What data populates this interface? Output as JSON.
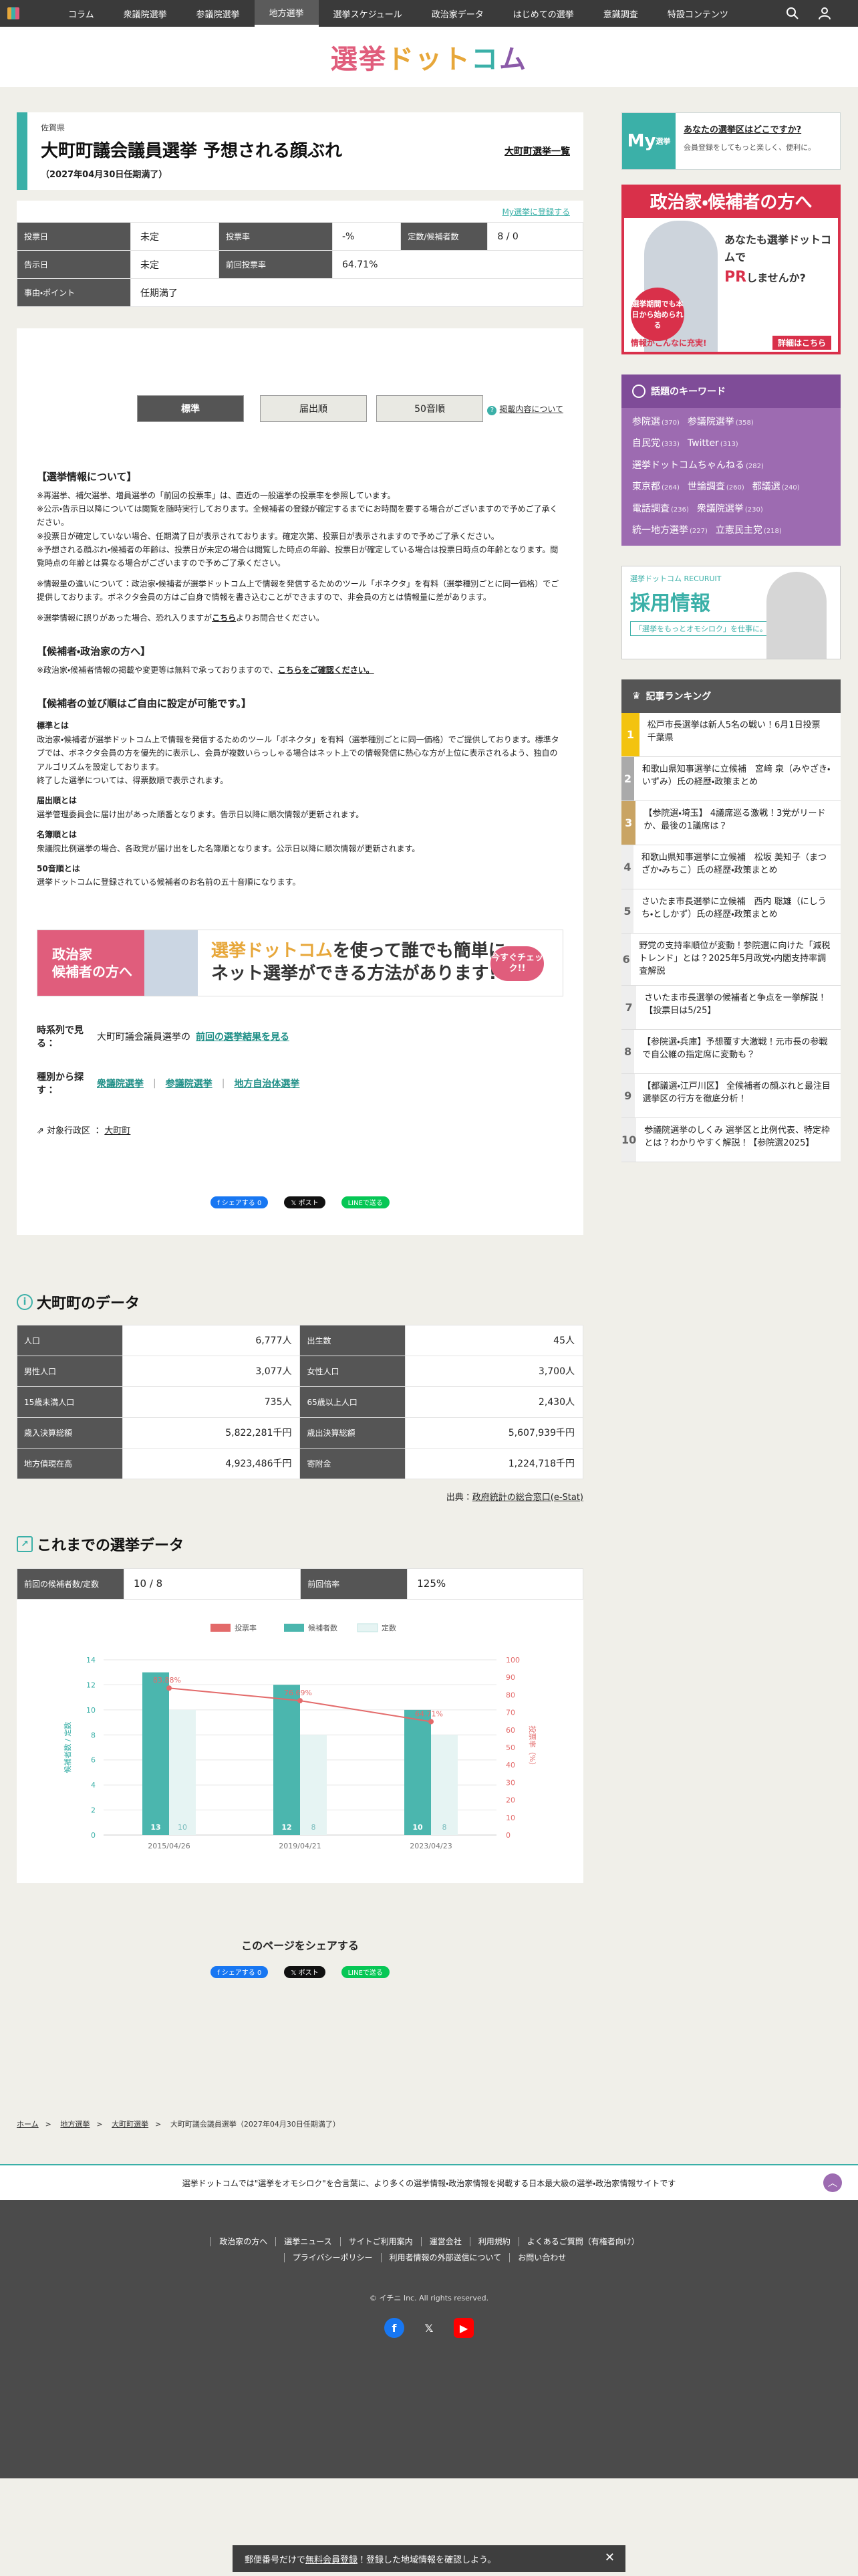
{
  "nav": {
    "items": [
      "コラム",
      "衆議院選挙",
      "参議院選挙",
      "地方選挙",
      "選挙スケジュール",
      "政治家データ",
      "はじめての選挙",
      "意識調査",
      "特設コンテンツ"
    ],
    "active_index": 3
  },
  "site": {
    "logo": [
      "選挙",
      "ドット",
      "コ",
      "ム"
    ]
  },
  "election": {
    "prefecture": "佐賀県",
    "title": "大町町議会議員選挙 予想される顔ぶれ",
    "date": "（2027年04月30日任期満了）",
    "list_link": "大町町選挙一覧"
  },
  "summary": {
    "register_link": "My選挙に登録する",
    "rows": [
      [
        {
          "label": "投票日",
          "value": "未定"
        },
        {
          "label": "投票率",
          "value": "-%"
        },
        {
          "label": "定数/候補者数",
          "value": "8 / 0"
        }
      ],
      [
        {
          "label": "告示日",
          "value": "未定"
        },
        {
          "label": "前回投票率",
          "value": "64.71%"
        }
      ],
      [
        {
          "label": "事由・ポイント",
          "value": "任期満了"
        }
      ]
    ]
  },
  "tabs": {
    "items": [
      "標準",
      "届出順",
      "50音順"
    ],
    "active": 0,
    "about": "掲載内容について"
  },
  "info": {
    "h1": "【選挙情報について】",
    "p1": "※再選挙、補欠選挙、増員選挙の「前回の投票率」は、直近の一般選挙の投票率を参照しています。",
    "p2": "※公示・告示日以降については閲覧を随時実行しております。全候補者の登録が確定するまでにお時間を要する場合がございますので予めご了承ください。",
    "p3": "※投票日が確定していない場合、任期満了日が表示されております。確定次第、投票日が表示されますので予めご了承ください。",
    "p4": "※予想される顔ぶれ・候補者の年齢は、投票日が未定の場合は閲覧した時点の年齢、投票日が確定している場合は投票日時点の年齢となります。閲覧時点の年齢とは異なる場合がございますので予めご了承ください。",
    "p5": "※情報量の違いについて：政治家・候補者が選挙ドットコム上で情報を発信するためのツール「ボネクタ」を有料（選挙種別ごとに同一価格）でご提供しております。ボネクタ会員の方はご自身で情報を書き込むことができますので、非会員の方とは情報量に差があります。",
    "p6a": "※選挙情報に誤りがあった場合、恐れ入りますが",
    "p6b": "こちら",
    "p6c": "よりお問合せください。",
    "h2": "【候補者・政治家の方へ】",
    "p7a": "※政治家・候補者情報の掲載や変更等は無料で承っておりますので、",
    "p7b": "こちらをご確認ください。",
    "h3": "【候補者の並び順はご自由に設定が可能です。】",
    "s1": "標準とは",
    "s1t": "政治家・候補者が選挙ドットコム上で情報を発信するためのツール「ボネクタ」を有料（選挙種別ごとに同一価格）でご提供しております。標準タブでは、ボネクタ会員の方を優先的に表示し、会員が複数いらっしゃる場合はネット上での情報発信に熱心な方が上位に表示されるよう、独自のアルゴリズムを設定しております。",
    "s1t2": "終了した選挙については、得票数順で表示されます。",
    "s2": "届出順とは",
    "s2t": "選挙管理委員会に届け出があった順番となります。告示日以降に順次情報が更新されます。",
    "s3": "名簿順とは",
    "s3t": "衆議院比例選挙の場合、各政党が届け出をした名簿順となります。公示日以降に順次情報が更新されます。",
    "s4": "50音順とは",
    "s4t": "選挙ドットコムに登録されている候補者のお名前の五十音順になります。"
  },
  "banner": {
    "left1": "政治家",
    "left2": "候補者の方へ",
    "brand": "選挙ドットコム",
    "right1": "を使って誰でも簡単に",
    "right2": "ネット選挙ができる方法があります!",
    "check": "今すぐチェック!!"
  },
  "timeline": {
    "label": "時系列で見る：",
    "prefix": "大町町議会議員選挙の",
    "link": "前回の選挙結果を見る"
  },
  "types": {
    "label": "種別から探す：",
    "items": [
      "衆議院選挙",
      "参議院選挙",
      "地方自治体選挙"
    ]
  },
  "area": {
    "label": "対象行政区",
    "value": "大町町"
  },
  "share": {
    "title": "このページをシェアする",
    "fb": "f シェアする 0",
    "x": "𝕏 ポスト",
    "line": "LINEで送る"
  },
  "town": {
    "title": "大町町のデータ",
    "rows": [
      [
        "人口",
        "6,777人",
        "出生数",
        "45人"
      ],
      [
        "男性人口",
        "3,077人",
        "女性人口",
        "3,700人"
      ],
      [
        "15歳未満人口",
        "735人",
        "65歳以上人口",
        "2,430人"
      ],
      [
        "歳入決算総額",
        "5,822,281千円",
        "歳出決算総額",
        "5,607,939千円"
      ],
      [
        "地方債現在高",
        "4,923,486千円",
        "寄附金",
        "1,224,718千円"
      ]
    ],
    "source_prefix": "出典：",
    "source_link": "政府統計の総合窓口(e-Stat)"
  },
  "history": {
    "title": "これまでの選挙データ",
    "row": [
      {
        "label": "前回の候補者数/定数",
        "value": "10 / 8"
      },
      {
        "label": "前回倍率",
        "value": "125%"
      }
    ]
  },
  "chart_data": {
    "type": "bar",
    "categories": [
      "2015/04/26",
      "2019/04/21",
      "2023/04/23"
    ],
    "series": [
      {
        "name": "候補者数",
        "type": "bar",
        "values": [
          13,
          12,
          10
        ],
        "color": "#4bb6ae"
      },
      {
        "name": "定数",
        "type": "bar",
        "values": [
          10,
          8,
          8
        ],
        "color": "#e6f4f3"
      },
      {
        "name": "投票率",
        "type": "line",
        "values": [
          83.88,
          76.69,
          64.71
        ],
        "color": "#e36a6a"
      }
    ],
    "line_labels": [
      "83.88%",
      "76.69%",
      "64.71%"
    ],
    "ylabel_left": "候補者数 / 定数",
    "ylabel_right": "投票率（%）",
    "ylim_left": [
      0,
      14
    ],
    "ylim_right": [
      0,
      100
    ],
    "left_ticks": [
      "0",
      "2",
      "4",
      "6",
      "8",
      "10",
      "12",
      "14"
    ],
    "right_ticks": [
      "0",
      "10",
      "20",
      "30",
      "40",
      "50",
      "60",
      "70",
      "80",
      "90",
      "100"
    ],
    "legend": [
      "投票率",
      "候補者数",
      "定数"
    ]
  },
  "sidebar": {
    "my_badge": "My",
    "my_badge_small": "選挙",
    "my_q": "あなたの選挙区はどこですか?",
    "my_d": "会員登録をしてもっと楽しく、便利に。",
    "ad_t1": "政治家・候補者の方へ",
    "ad_t2a": "あなたも",
    "ad_t2b": "選挙ドットコム",
    "ad_t2c": "で",
    "ad_t2d": "PR",
    "ad_t2e": "しませんか?",
    "ad_bubble": "選挙期間でも本日から始められる",
    "ad_foot_a": "情報がこんなに充実!",
    "ad_foot_b": "詳細はこちら",
    "kw_title": "話題のキーワード",
    "kw_lines": [
      [
        [
          "参院選",
          "(370)"
        ],
        [
          "参議院選挙",
          "(358)"
        ]
      ],
      [
        [
          "自民党",
          "(333)"
        ],
        [
          "Twitter",
          "(313)"
        ]
      ],
      [
        [
          "選挙ドットコムちゃんねる",
          "(282)"
        ]
      ],
      [
        [
          "東京都",
          "(264)"
        ],
        [
          "世論調査",
          "(260)"
        ],
        [
          "都議選",
          "(240)"
        ]
      ],
      [
        [
          "電話調査",
          "(236)"
        ],
        [
          "衆議院選挙",
          "(230)"
        ]
      ],
      [
        [
          "統一地方選挙",
          "(227)"
        ],
        [
          "立憲民主党",
          "(218)"
        ]
      ]
    ],
    "recruit_logo": "選挙ドットコム RECURUIT",
    "recruit_big": "採用情報",
    "recruit_small": "「選挙をもっとオモシロク」を仕事に。",
    "rank_title": "記事ランキング",
    "ranking": [
      "松戸市長選挙は新人5名の戦い！6月1日投票　千葉県",
      "和歌山県知事選挙に立候補　宮﨑 泉（みやざき・いずみ）氏の経歴・政策まとめ",
      "【参院選・埼玉】 4議席巡る激戦！3党がリードか、最後の1議席は？",
      "和歌山県知事選挙に立候補　松坂 美知子（まつざか・みちこ）氏の経歴・政策まとめ",
      "さいたま市長選挙に立候補　西内 聡雄（にしうち・としかず）氏の経歴・政策まとめ",
      "野党の支持率順位が変動！参院選に向けた「減税トレンド」とは？2025年5月政党・内閣支持率調査解説",
      "さいたま市長選挙の候補者と争点を一挙解説！【投票日は5/25】",
      "【参院選・兵庫】予想覆す大激戦！元市長の参戦で自公維の指定席に変動も？",
      "【都議選・江戸川区】 全候補者の顔ぶれと最注目選挙区の行方を徹底分析！",
      "参議院選挙のしくみ 選挙区と比例代表、特定枠とは？わかりやすく解説！【参院選2025】"
    ]
  },
  "breadcrumb": [
    "ホーム",
    "地方選挙",
    "大町町選挙",
    "大町町議会議員選挙（2027年04月30日任期満了）"
  ],
  "footer": {
    "tagline": "選挙ドットコムでは\"選挙をオモシロク\"を合言葉に、より多くの選挙情報・政治家情報を掲載する日本最大級の選挙・政治家情報サイトです",
    "links": [
      "政治家の方へ",
      "選挙ニュース",
      "サイトご利用案内",
      "運営会社",
      "利用規約",
      "よくあるご質問（有権者向け）",
      "プライバシーポリシー",
      "利用者情報の外部送信について",
      "お問い合わせ"
    ],
    "copyright": "© イチニ Inc. All rights reserved."
  },
  "bottom_bar": {
    "a": "郵便番号だけで",
    "b": "無料会員登録",
    "c": "！登録した地域情報を確認しよう。"
  },
  "colors": {
    "accent": "#3bb0a8",
    "purple": "#9d6bb1",
    "red": "#e05d7c",
    "nav_bg": "#3a3a3a"
  }
}
